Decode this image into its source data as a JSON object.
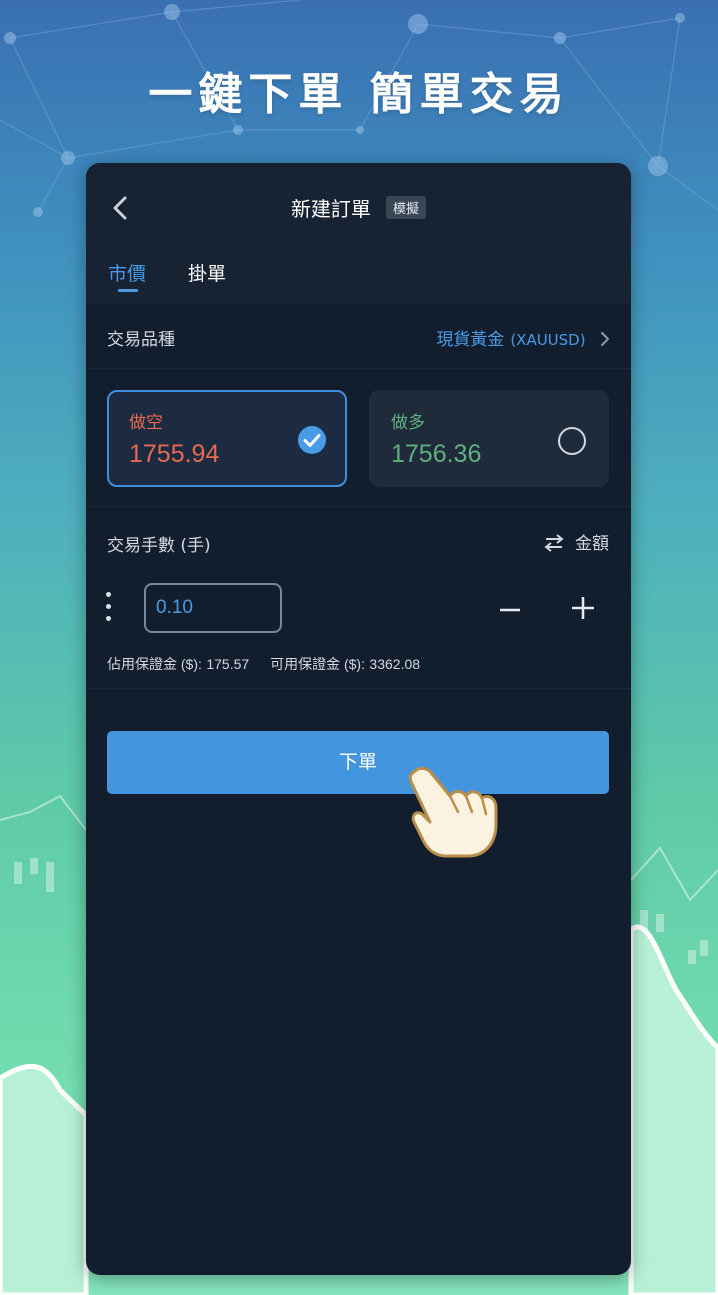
{
  "hero": {
    "title": "一鍵下單 簡單交易"
  },
  "header": {
    "title": "新建訂單",
    "badge": "模擬"
  },
  "tabs": [
    {
      "label": "市價",
      "active": true
    },
    {
      "label": "掛單",
      "active": false
    }
  ],
  "product": {
    "label": "交易品種",
    "name": "現貨黃金",
    "code": "(XAUUSD)"
  },
  "sides": {
    "sell": {
      "label": "做空",
      "price": "1755.94",
      "selected": true
    },
    "buy": {
      "label": "做多",
      "price": "1756.36",
      "selected": false
    }
  },
  "lots": {
    "label": "交易手數 (手)",
    "toggle_label": "金額",
    "value": "0.10"
  },
  "margin": {
    "used_label": "佔用保證金 ($):",
    "used_value": "175.57",
    "available_label": "可用保證金 ($):",
    "available_value": "3362.08"
  },
  "submit": {
    "label": "下單"
  },
  "colors": {
    "accent": "#4395de",
    "sell": "#e8694e",
    "buy": "#5eb07e",
    "panel": "#121d2d"
  },
  "icons": {
    "back": "back-chevron-icon",
    "next": "chevron-right-icon",
    "check": "check-circle-icon",
    "radio": "radio-empty-icon",
    "swap": "swap-arrows-icon",
    "drag": "drag-dots-icon",
    "minus": "minus-icon",
    "plus": "plus-icon",
    "pointer": "pointing-hand-icon"
  }
}
